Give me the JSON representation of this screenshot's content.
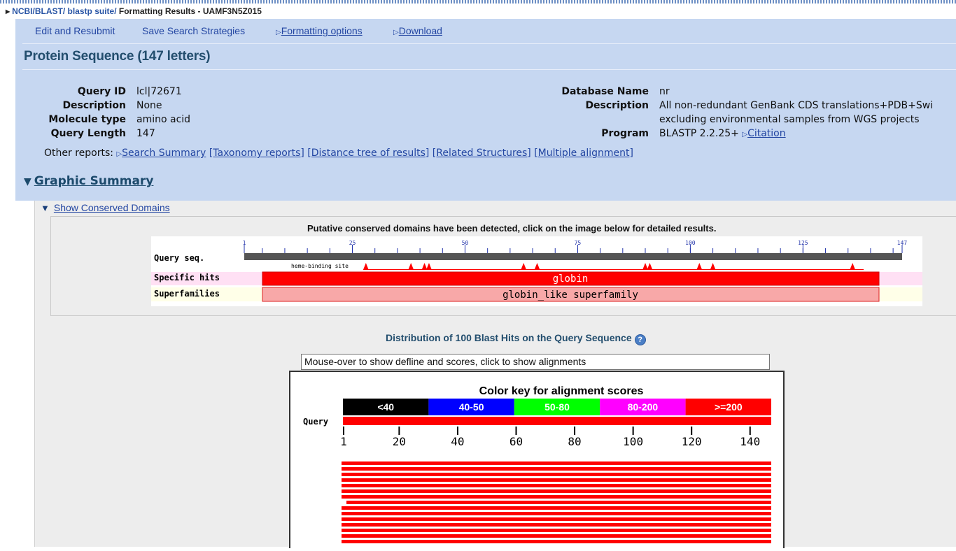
{
  "breadcrumb": {
    "part1": "NCBI/",
    "part2": "BLAST/",
    "part3": "blastp suite/",
    "part4": "Formatting Results - UAMF3N5Z015"
  },
  "toolbar": {
    "edit_resubmit": "Edit and Resubmit",
    "save_strategies": "Save Search Strategies",
    "formatting_options": "Formatting options",
    "download": "Download"
  },
  "page_title": "Protein Sequence (147 letters)",
  "query": {
    "query_id_label": "Query ID",
    "query_id": "lcl|72671",
    "description_label": "Description",
    "description": "None",
    "molecule_type_label": "Molecule type",
    "molecule_type": "amino acid",
    "query_length_label": "Query Length",
    "query_length": "147"
  },
  "database": {
    "name_label": "Database Name",
    "name": "nr",
    "description_label": "Description",
    "description_line1": "All non-redundant GenBank CDS translations+PDB+Swi",
    "description_line2": "excluding environmental samples from WGS projects",
    "program_label": "Program",
    "program": "BLASTP 2.2.25+",
    "citation": "Citation"
  },
  "other_reports": {
    "label": "Other reports:",
    "search_summary": "Search Summary",
    "taxonomy": "[Taxonomy reports]",
    "distance_tree": "[Distance tree of results]",
    "related_structures": "[Related Structures]",
    "multiple_alignment": "[Multiple alignment]"
  },
  "graphic_summary": {
    "title": "Graphic Summary",
    "show_conserved": "Show Conserved Domains",
    "putative_msg": "Putative conserved domains have been detected, click on the image below for detailed results."
  },
  "domain_image": {
    "query_seq_label": "Query seq.",
    "ruler_ticks": [
      "1",
      "25",
      "50",
      "75",
      "100",
      "125",
      "147"
    ],
    "site_label": "heme-binding site",
    "specific_hits_label": "Specific hits",
    "specific_hit": "globin",
    "superfamilies_label": "Superfamilies",
    "superfamily": "globin_like superfamily",
    "site_positions": [
      28,
      38,
      41,
      42,
      63,
      66,
      90,
      91,
      102,
      105,
      136
    ],
    "colors": {
      "hit": "#ff0000",
      "superfamily": "#f8a8a8",
      "specific_bg": "#ffe0f4",
      "super_bg": "#ffffe8",
      "ruler": "#555555"
    }
  },
  "distribution": {
    "title": "Distribution of 100 Blast Hits on the Query Sequence",
    "mouseover": "Mouse-over to show defline and scores, click to show alignments",
    "color_key_title": "Color key for alignment scores",
    "color_key": [
      {
        "label": "<40",
        "color": "#000000"
      },
      {
        "label": "40-50",
        "color": "#0000ff"
      },
      {
        "label": "50-80",
        "color": "#00ff00"
      },
      {
        "label": "80-200",
        "color": "#ff00ff"
      },
      {
        "label": ">=200",
        "color": "#ff0000"
      }
    ],
    "query_label": "Query",
    "axis_ticks": [
      "1",
      "20",
      "40",
      "60",
      "80",
      "100",
      "120",
      "140"
    ],
    "hit_color": "#ff0000",
    "visible_hit_bars": 15
  }
}
